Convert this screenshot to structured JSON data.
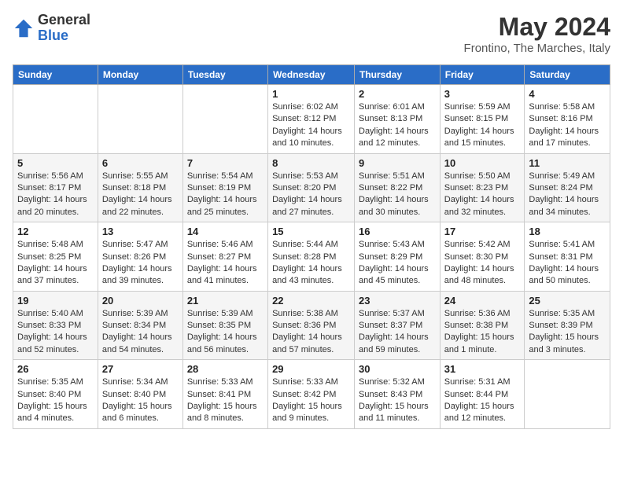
{
  "logo": {
    "general": "General",
    "blue": "Blue"
  },
  "header": {
    "month": "May 2024",
    "location": "Frontino, The Marches, Italy"
  },
  "weekdays": [
    "Sunday",
    "Monday",
    "Tuesday",
    "Wednesday",
    "Thursday",
    "Friday",
    "Saturday"
  ],
  "weeks": [
    [
      {
        "day": "",
        "info": ""
      },
      {
        "day": "",
        "info": ""
      },
      {
        "day": "",
        "info": ""
      },
      {
        "day": "1",
        "info": "Sunrise: 6:02 AM\nSunset: 8:12 PM\nDaylight: 14 hours\nand 10 minutes."
      },
      {
        "day": "2",
        "info": "Sunrise: 6:01 AM\nSunset: 8:13 PM\nDaylight: 14 hours\nand 12 minutes."
      },
      {
        "day": "3",
        "info": "Sunrise: 5:59 AM\nSunset: 8:15 PM\nDaylight: 14 hours\nand 15 minutes."
      },
      {
        "day": "4",
        "info": "Sunrise: 5:58 AM\nSunset: 8:16 PM\nDaylight: 14 hours\nand 17 minutes."
      }
    ],
    [
      {
        "day": "5",
        "info": "Sunrise: 5:56 AM\nSunset: 8:17 PM\nDaylight: 14 hours\nand 20 minutes."
      },
      {
        "day": "6",
        "info": "Sunrise: 5:55 AM\nSunset: 8:18 PM\nDaylight: 14 hours\nand 22 minutes."
      },
      {
        "day": "7",
        "info": "Sunrise: 5:54 AM\nSunset: 8:19 PM\nDaylight: 14 hours\nand 25 minutes."
      },
      {
        "day": "8",
        "info": "Sunrise: 5:53 AM\nSunset: 8:20 PM\nDaylight: 14 hours\nand 27 minutes."
      },
      {
        "day": "9",
        "info": "Sunrise: 5:51 AM\nSunset: 8:22 PM\nDaylight: 14 hours\nand 30 minutes."
      },
      {
        "day": "10",
        "info": "Sunrise: 5:50 AM\nSunset: 8:23 PM\nDaylight: 14 hours\nand 32 minutes."
      },
      {
        "day": "11",
        "info": "Sunrise: 5:49 AM\nSunset: 8:24 PM\nDaylight: 14 hours\nand 34 minutes."
      }
    ],
    [
      {
        "day": "12",
        "info": "Sunrise: 5:48 AM\nSunset: 8:25 PM\nDaylight: 14 hours\nand 37 minutes."
      },
      {
        "day": "13",
        "info": "Sunrise: 5:47 AM\nSunset: 8:26 PM\nDaylight: 14 hours\nand 39 minutes."
      },
      {
        "day": "14",
        "info": "Sunrise: 5:46 AM\nSunset: 8:27 PM\nDaylight: 14 hours\nand 41 minutes."
      },
      {
        "day": "15",
        "info": "Sunrise: 5:44 AM\nSunset: 8:28 PM\nDaylight: 14 hours\nand 43 minutes."
      },
      {
        "day": "16",
        "info": "Sunrise: 5:43 AM\nSunset: 8:29 PM\nDaylight: 14 hours\nand 45 minutes."
      },
      {
        "day": "17",
        "info": "Sunrise: 5:42 AM\nSunset: 8:30 PM\nDaylight: 14 hours\nand 48 minutes."
      },
      {
        "day": "18",
        "info": "Sunrise: 5:41 AM\nSunset: 8:31 PM\nDaylight: 14 hours\nand 50 minutes."
      }
    ],
    [
      {
        "day": "19",
        "info": "Sunrise: 5:40 AM\nSunset: 8:33 PM\nDaylight: 14 hours\nand 52 minutes."
      },
      {
        "day": "20",
        "info": "Sunrise: 5:39 AM\nSunset: 8:34 PM\nDaylight: 14 hours\nand 54 minutes."
      },
      {
        "day": "21",
        "info": "Sunrise: 5:39 AM\nSunset: 8:35 PM\nDaylight: 14 hours\nand 56 minutes."
      },
      {
        "day": "22",
        "info": "Sunrise: 5:38 AM\nSunset: 8:36 PM\nDaylight: 14 hours\nand 57 minutes."
      },
      {
        "day": "23",
        "info": "Sunrise: 5:37 AM\nSunset: 8:37 PM\nDaylight: 14 hours\nand 59 minutes."
      },
      {
        "day": "24",
        "info": "Sunrise: 5:36 AM\nSunset: 8:38 PM\nDaylight: 15 hours\nand 1 minute."
      },
      {
        "day": "25",
        "info": "Sunrise: 5:35 AM\nSunset: 8:39 PM\nDaylight: 15 hours\nand 3 minutes."
      }
    ],
    [
      {
        "day": "26",
        "info": "Sunrise: 5:35 AM\nSunset: 8:40 PM\nDaylight: 15 hours\nand 4 minutes."
      },
      {
        "day": "27",
        "info": "Sunrise: 5:34 AM\nSunset: 8:40 PM\nDaylight: 15 hours\nand 6 minutes."
      },
      {
        "day": "28",
        "info": "Sunrise: 5:33 AM\nSunset: 8:41 PM\nDaylight: 15 hours\nand 8 minutes."
      },
      {
        "day": "29",
        "info": "Sunrise: 5:33 AM\nSunset: 8:42 PM\nDaylight: 15 hours\nand 9 minutes."
      },
      {
        "day": "30",
        "info": "Sunrise: 5:32 AM\nSunset: 8:43 PM\nDaylight: 15 hours\nand 11 minutes."
      },
      {
        "day": "31",
        "info": "Sunrise: 5:31 AM\nSunset: 8:44 PM\nDaylight: 15 hours\nand 12 minutes."
      },
      {
        "day": "",
        "info": ""
      }
    ]
  ]
}
